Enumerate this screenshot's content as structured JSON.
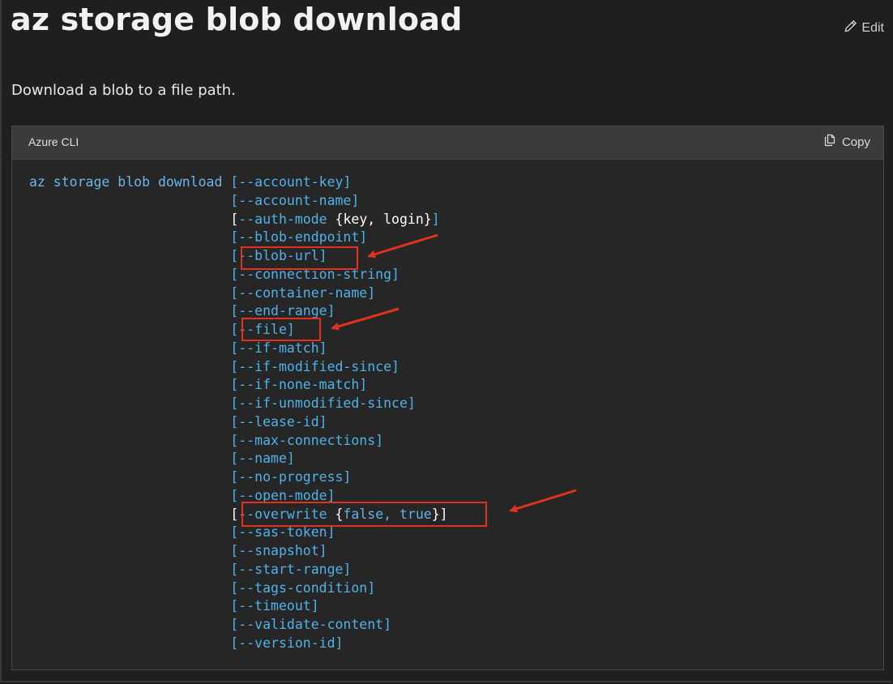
{
  "page": {
    "title": "az storage blob download",
    "edit_label": "Edit",
    "description": "Download a blob to a file path."
  },
  "code_block": {
    "language": "Azure CLI",
    "copy_label": "Copy",
    "command": "az storage blob download",
    "params": [
      "[--account-key]",
      "[--account-name]",
      "[--auth-mode {key, login}]",
      "[--blob-endpoint]",
      "[--blob-url]",
      "[--connection-string]",
      "[--container-name]",
      "[--end-range]",
      "[--file]",
      "[--if-match]",
      "[--if-modified-since]",
      "[--if-none-match]",
      "[--if-unmodified-since]",
      "[--lease-id]",
      "[--max-connections]",
      "[--name]",
      "[--no-progress]",
      "[--open-mode]",
      "[--overwrite {false, true}]",
      "[--sas-token]",
      "[--snapshot]",
      "[--start-range]",
      "[--tags-condition]",
      "[--timeout]",
      "[--validate-content]",
      "[--version-id]"
    ],
    "highlighted_params": [
      "[--blob-url]",
      "[--file]",
      "[--overwrite {false, true}]"
    ]
  },
  "colors": {
    "background": "#1f1f1f",
    "code_background": "#262626",
    "code_header": "#3b3b3b",
    "parameter_text": "#4fc3f7",
    "annotation_red": "#e0321e"
  }
}
